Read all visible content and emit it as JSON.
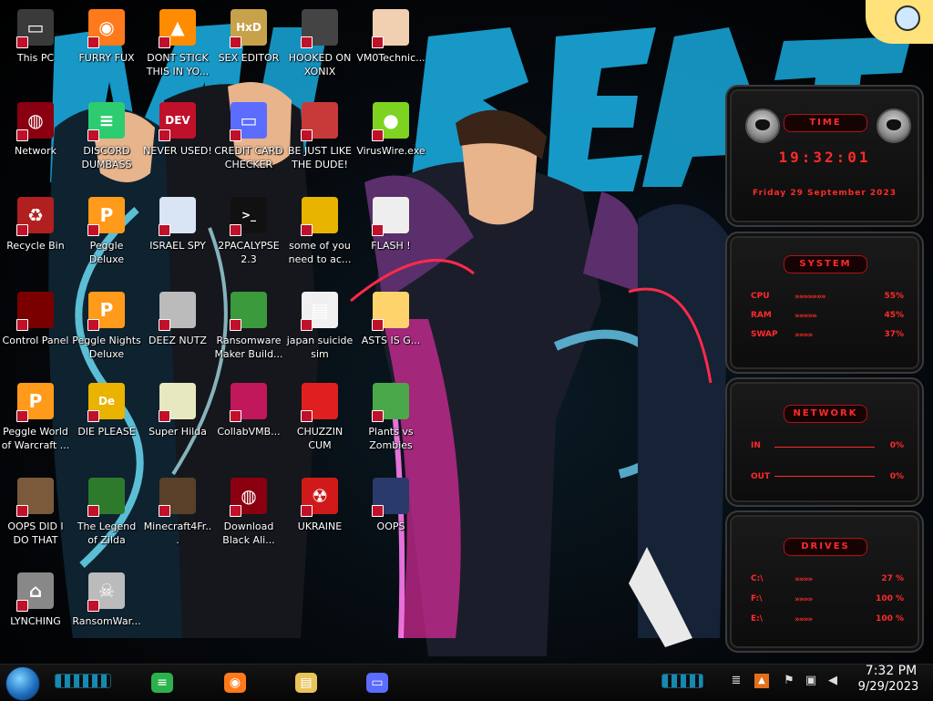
{
  "desktop_icons": [
    {
      "label": "This PC",
      "icon": "computer-icon"
    },
    {
      "label": "FURRY FUX",
      "icon": "firefox-icon"
    },
    {
      "label": "DONT STICK THIS IN YO...",
      "icon": "vlc-cone-icon"
    },
    {
      "label": "SEX EDITOR",
      "icon": "hex-editor-icon"
    },
    {
      "label": "HOOKED ON XONIX",
      "icon": "game-icon"
    },
    {
      "label": "VM0Technic...",
      "icon": "doctor-icon"
    },
    {
      "label": "Network",
      "icon": "network-icon"
    },
    {
      "label": "DISCORD DUMBASS",
      "icon": "discord-icon"
    },
    {
      "label": "NEVER USED!",
      "icon": "devcpp-icon"
    },
    {
      "label": "CREDIT CARD CHECKER",
      "icon": "credit-card-icon"
    },
    {
      "label": "BE JUST LIKE THE DUDE!",
      "icon": "santa-icon"
    },
    {
      "label": "VirusWire.exe",
      "icon": "lime-icon"
    },
    {
      "label": "Recycle Bin",
      "icon": "recycle-bin-icon"
    },
    {
      "label": "Peggle Deluxe",
      "icon": "peggle-icon"
    },
    {
      "label": "ISRAEL SPY",
      "icon": "spy-icon"
    },
    {
      "label": "2PACALYPSE 2.3",
      "icon": "terminal-icon"
    },
    {
      "label": "some of you need to ac...",
      "icon": "beaver-icon"
    },
    {
      "label": "FLASH !",
      "icon": "flash-icon"
    },
    {
      "label": "Control Panel",
      "icon": "control-panel-icon"
    },
    {
      "label": "Peggle Nights Deluxe",
      "icon": "peggle-icon"
    },
    {
      "label": "DEEZ NUTZ",
      "icon": "windows-stack-icon"
    },
    {
      "label": "Ransomware Maker Build...",
      "icon": "window-app-icon"
    },
    {
      "label": "japan suicide sim",
      "icon": "file-icon"
    },
    {
      "label": "ASTS IS G...",
      "icon": "star-butterfly-icon"
    },
    {
      "label": "Peggle World of Warcraft ...",
      "icon": "peggle-icon"
    },
    {
      "label": "DIE PLEASE",
      "icon": "de-icon"
    },
    {
      "label": "Super Hilda",
      "icon": "pixel-dog-icon"
    },
    {
      "label": "CollabVMB...",
      "icon": "collabvm-icon"
    },
    {
      "label": "CHUZZIN CUM",
      "icon": "chuzzle-icon"
    },
    {
      "label": "Plants vs Zombies",
      "icon": "plant-icon"
    },
    {
      "label": "OOPS DID I DO THAT",
      "icon": "portrait-icon"
    },
    {
      "label": "The Legend of Zilda",
      "icon": "zelda-icon"
    },
    {
      "label": "Minecraft4Fr...",
      "icon": "grass-block-icon"
    },
    {
      "label": "Download Black Ali...",
      "icon": "alienware-icon"
    },
    {
      "label": "UKRAINE",
      "icon": "radiation-icon"
    },
    {
      "label": "OOPS",
      "icon": "oops-icon"
    },
    {
      "label": "LYNCHING",
      "icon": "house-icon"
    },
    {
      "label": "RansomWar...",
      "icon": "skull-icon"
    }
  ],
  "gadgets": {
    "time": {
      "header": "TIME",
      "clock": "19:32:01",
      "date": "Friday 29 September 2023"
    },
    "system": {
      "header": "SYSTEM",
      "rows": [
        {
          "key": "CPU",
          "value": "55%",
          "level": 0.55
        },
        {
          "key": "RAM",
          "value": "45%",
          "level": 0.45
        },
        {
          "key": "SWAP",
          "value": "37%",
          "level": 0.37
        }
      ]
    },
    "network": {
      "header": "NETWORK",
      "rows": [
        {
          "key": "IN",
          "value": "0%"
        },
        {
          "key": "OUT",
          "value": "0%"
        }
      ]
    },
    "drives": {
      "header": "DRIVES",
      "rows": [
        {
          "key": "C:\\",
          "value": "27 %"
        },
        {
          "key": "F:\\",
          "value": "100 %"
        },
        {
          "key": "E:\\",
          "value": "100 %"
        }
      ]
    }
  },
  "taskbar": {
    "pinned": [
      {
        "name": "Feedly",
        "icon": "feedly-icon"
      },
      {
        "name": "Firefox",
        "icon": "firefox-icon"
      },
      {
        "name": "File Explorer",
        "icon": "folder-icon"
      },
      {
        "name": "Credit Card Checker",
        "icon": "credit-card-icon"
      }
    ],
    "tray": [
      "tray-chevron-icon",
      "tray-app-icon",
      "flag-icon",
      "network-tray-icon",
      "volume-icon"
    ],
    "time": "7:32 PM",
    "date": "9/29/2023"
  },
  "colors": {
    "accent": "#ff2a2a",
    "wallpaper_cyan": "#1ab3e6",
    "wallpaper_pink": "#ff2fb0"
  }
}
